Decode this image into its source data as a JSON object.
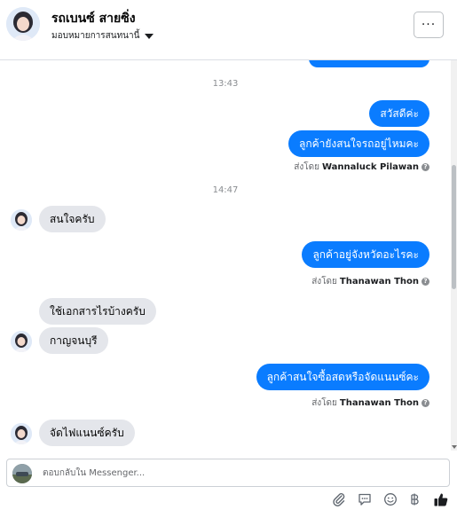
{
  "header": {
    "contact_name": "รถเบนซ์ สายซิ่ง",
    "assign_label": "มอบหมายการสนทนานี้",
    "more_label": "···"
  },
  "thread": {
    "time1": "13:43",
    "msg_out_1": "สวัสดีค่ะ",
    "msg_out_2": "ลูกค้ายังสนใจรถอยู่ไหมคะ",
    "sent_by_prefix": "ส่งโดย",
    "sender_1": "Wannaluck Pilawan",
    "time2": "14:47",
    "msg_in_1": "สนใจครับ",
    "msg_out_3": "ลูกค้าอยู่จังหวัดอะไรคะ",
    "sender_2": "Thanawan Thon",
    "msg_in_2": "ใช้เอกสารไรบ้างครับ",
    "msg_in_3": "กาญจนบุรี",
    "msg_out_4": "ลูกค้าสนใจซื้อสดหรือจัดแนนซ์คะ",
    "sender_3": "Thanawan Thon",
    "msg_in_4": "จัดไฟแนนซ์ครับ"
  },
  "composer": {
    "placeholder": "ตอบกลับใน Messenger..."
  },
  "icons": [
    "attach-icon",
    "saved-reply-icon",
    "emoji-icon",
    "baht-icon",
    "like-icon"
  ],
  "colors": {
    "outgoing_bubble": "#0a7cff",
    "incoming_bubble": "#e4e6eb"
  }
}
